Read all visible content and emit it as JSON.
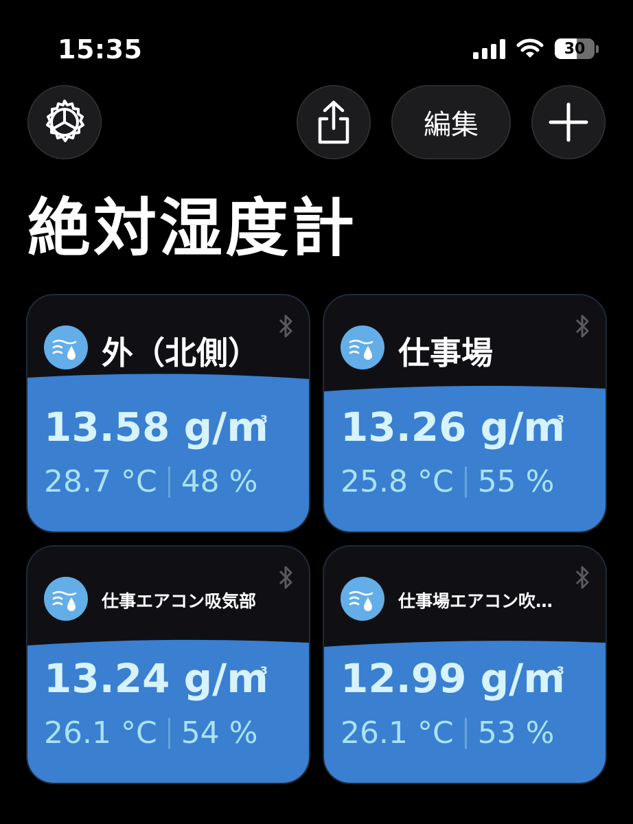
{
  "status_bar": {
    "time": "15:35",
    "battery_level": "30"
  },
  "toolbar": {
    "edit_label": "編集"
  },
  "title": "絶対湿度計",
  "colors": {
    "accent": "#3a7fd0",
    "icon_bg": "#63aee8",
    "value_text": "#d6f3ff"
  },
  "cards": [
    {
      "name": "外（北側）",
      "absolute": "13.58 g/m",
      "unit_sup": "3",
      "temperature": "28.7 °C",
      "humidity": "48 %"
    },
    {
      "name": "仕事場",
      "absolute": "13.26 g/m",
      "unit_sup": "3",
      "temperature": "25.8 °C",
      "humidity": "55 %"
    },
    {
      "name": "仕事エアコン吸気部",
      "absolute": "13.24 g/m",
      "unit_sup": "3",
      "temperature": "26.1 °C",
      "humidity": "54 %"
    },
    {
      "name": "仕事場エアコン吹…",
      "absolute": "12.99 g/m",
      "unit_sup": "3",
      "temperature": "26.1 °C",
      "humidity": "53 %"
    }
  ]
}
